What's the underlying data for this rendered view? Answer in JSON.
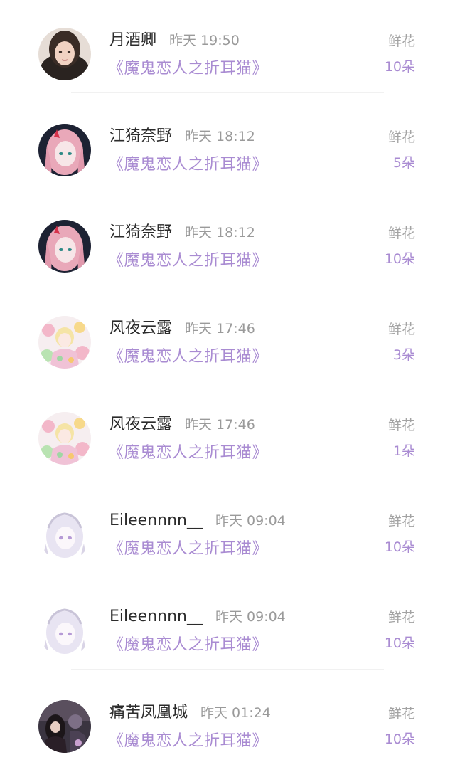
{
  "items": [
    {
      "name": "月酒卿",
      "time": "昨天 19:50",
      "book": "《魔鬼恋人之折耳猫》",
      "flower_label": "鲜花",
      "flower_count": "10朵",
      "avatar": "avatar-portrait-icon"
    },
    {
      "name": "江猗奈野",
      "time": "昨天 18:12",
      "book": "《魔鬼恋人之折耳猫》",
      "flower_label": "鲜花",
      "flower_count": "5朵",
      "avatar": "avatar-anime-pink-icon"
    },
    {
      "name": "江猗奈野",
      "time": "昨天 18:12",
      "book": "《魔鬼恋人之折耳猫》",
      "flower_label": "鲜花",
      "flower_count": "10朵",
      "avatar": "avatar-anime-pink-icon"
    },
    {
      "name": "风夜云露",
      "time": "昨天 17:46",
      "book": "《魔鬼恋人之折耳猫》",
      "flower_label": "鲜花",
      "flower_count": "3朵",
      "avatar": "avatar-floral-icon"
    },
    {
      "name": "风夜云露",
      "time": "昨天 17:46",
      "book": "《魔鬼恋人之折耳猫》",
      "flower_label": "鲜花",
      "flower_count": "1朵",
      "avatar": "avatar-floral-icon"
    },
    {
      "name": "Eileennnn__",
      "time": "昨天 09:04",
      "book": "《魔鬼恋人之折耳猫》",
      "flower_label": "鲜花",
      "flower_count": "10朵",
      "avatar": "avatar-anime-white-icon"
    },
    {
      "name": "Eileennnn__",
      "time": "昨天 09:04",
      "book": "《魔鬼恋人之折耳猫》",
      "flower_label": "鲜花",
      "flower_count": "10朵",
      "avatar": "avatar-anime-white-icon"
    },
    {
      "name": "痛苦凤凰城",
      "time": "昨天 01:24",
      "book": "《魔鬼恋人之折耳猫》",
      "flower_label": "鲜花",
      "flower_count": "10朵",
      "avatar": "avatar-dark-scene-icon"
    }
  ],
  "colors": {
    "accent": "#a98bd2",
    "name_text": "#2b2b2b",
    "muted_text": "#9a9a9a"
  }
}
